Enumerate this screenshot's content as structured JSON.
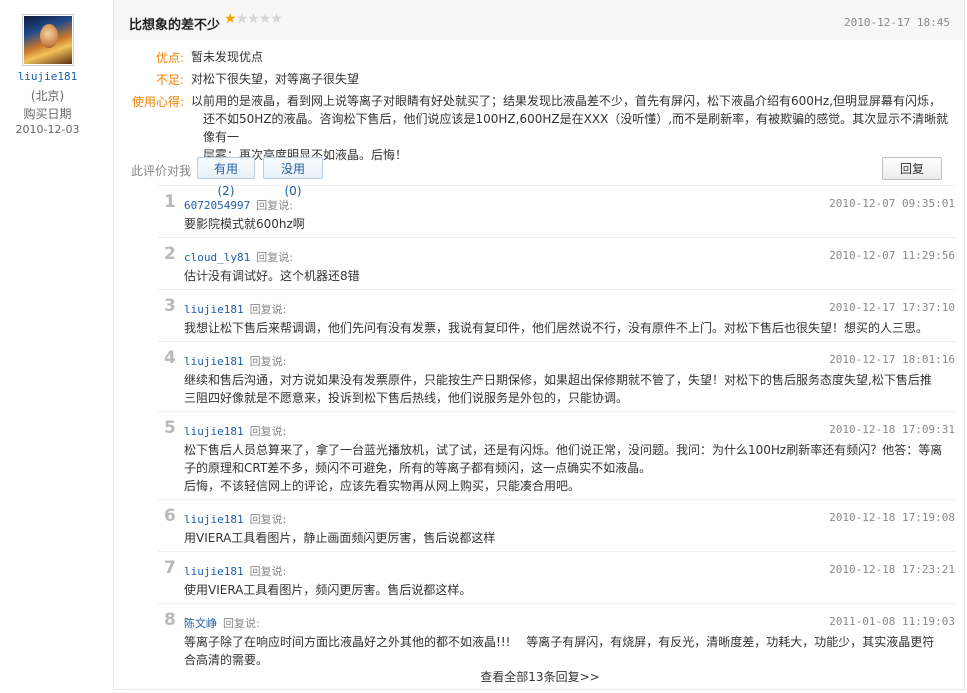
{
  "user": {
    "name": "liujie181",
    "location": "(北京)",
    "purchase_label": "购买日期",
    "purchase_date": "2010-12-03"
  },
  "review": {
    "title": "比想象的差不少",
    "rating": 1,
    "rating_max": 5,
    "date": "2010-12-17 18:45",
    "pros_label": "优点:",
    "pros": "暂未发现优点",
    "cons_label": "不足:",
    "cons": "对松下很失望，对等离子很失望",
    "experience_label": "使用心得:",
    "experience_lines": [
      "以前用的是液晶，看到网上说等离子对眼睛有好处就买了；结果发现比液晶差不少，首先有屏闪，松下液晶介绍有600Hz,但明显屏幕有闪烁，",
      "还不如50HZ的液晶。咨询松下售后，他们说应该是100HZ,600HZ是在XXX（没听懂）,而不是刷新率，有被欺骗的感觉。其次显示不清晰就像有一",
      "层雾；再次亮度明显不如液晶。后悔！"
    ]
  },
  "vote": {
    "label": "此评价对我",
    "useful": "有用 (2)",
    "useless": "没用 (0)",
    "reply_button": "回复"
  },
  "replies": [
    {
      "num": "1",
      "name": "6072054997",
      "said": "回复说:",
      "date": "2010-12-07 09:35:01",
      "lines": [
        "要影院模式就600hz啊"
      ]
    },
    {
      "num": "2",
      "name": "cloud_ly81",
      "said": "回复说:",
      "date": "2010-12-07 11:29:56",
      "lines": [
        "估计没有调试好。这个机器还8错"
      ]
    },
    {
      "num": "3",
      "name": "liujie181",
      "said": "回复说:",
      "date": "2010-12-17 17:37:10",
      "lines": [
        "我想让松下售后来帮调调，他们先问有没有发票，我说有复印件，他们居然说不行，没有原件不上门。对松下售后也很失望！想买的人三思。"
      ]
    },
    {
      "num": "4",
      "name": "liujie181",
      "said": "回复说:",
      "date": "2010-12-17 18:01:16",
      "lines": [
        "继续和售后沟通，对方说如果没有发票原件，只能按生产日期保修，如果超出保修期就不管了，失望！对松下的售后服务态度失望,松下售后推",
        "三阻四好像就是不愿意来，投诉到松下售后热线，他们说服务是外包的，只能协调。"
      ]
    },
    {
      "num": "5",
      "name": "liujie181",
      "said": "回复说:",
      "date": "2010-12-18 17:09:31",
      "lines": [
        "松下售后人员总算来了，拿了一台蓝光播放机，试了试，还是有闪烁。他们说正常，没问题。我问：为什么100Hz刷新率还有频闪？他答：等离",
        "子的原理和CRT差不多，频闪不可避免，所有的等离子都有频闪，这一点确实不如液晶。",
        "后悔，不该轻信网上的评论，应该先看实物再从网上购买，只能凑合用吧。"
      ]
    },
    {
      "num": "6",
      "name": "liujie181",
      "said": "回复说:",
      "date": "2010-12-18 17:19:08",
      "lines": [
        "用VIERA工具看图片，静止画面频闪更厉害，售后说都这样"
      ]
    },
    {
      "num": "7",
      "name": "liujie181",
      "said": "回复说:",
      "date": "2010-12-18 17:23:21",
      "lines": [
        "使用VIERA工具看图片，频闪更厉害。售后说都这样。"
      ]
    },
    {
      "num": "8",
      "name": "陈文峥",
      "said": "回复说:",
      "date": "2011-01-08 11:19:03",
      "lines": [
        "等离子除了在响应时间方面比液晶好之外其他的都不如液晶!!!　 等离子有屏闪，有烧屏，有反光，清晰度差，功耗大，功能少，其实液晶更符",
        "合高清的需要。"
      ]
    }
  ],
  "more_link": "查看全部13条回复>>"
}
